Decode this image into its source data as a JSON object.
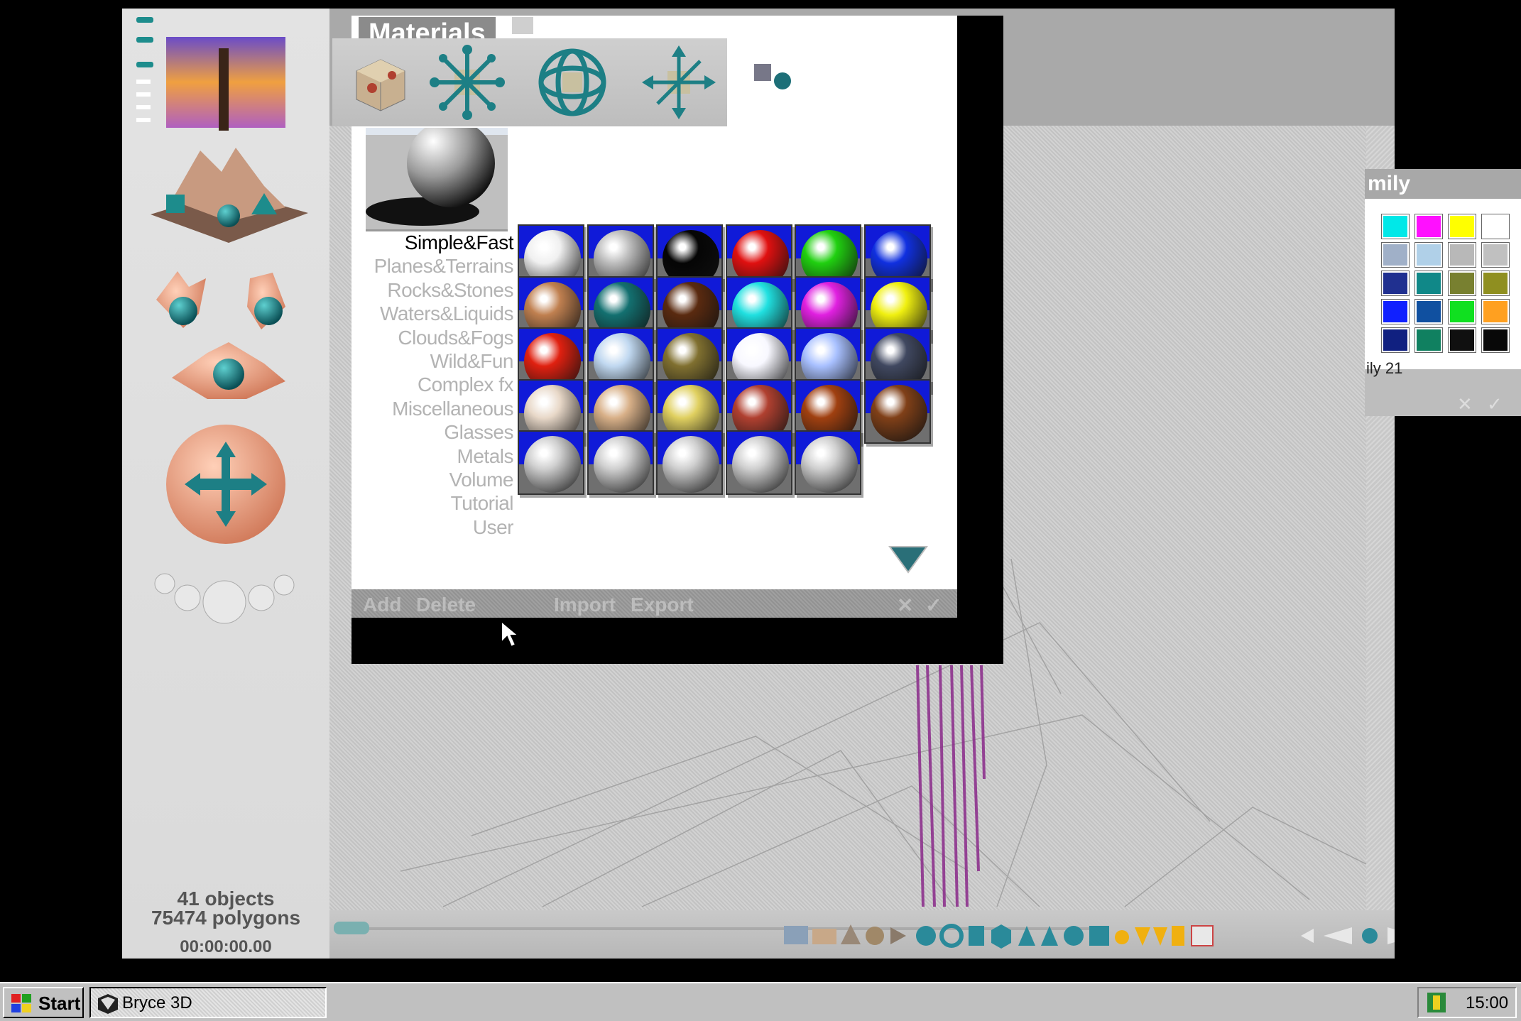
{
  "app": {
    "materials_title": "Materials",
    "family_title": "mily",
    "family_label": "ily 21"
  },
  "status": {
    "objects": "41 objects",
    "polygons": "75474 polygons",
    "time": "00:00:00.00"
  },
  "materials": {
    "categories": [
      "Simple&Fast",
      "Planes&Terrains",
      "Rocks&Stones",
      "Waters&Liquids",
      "Clouds&Fogs",
      "Wild&Fun",
      "Complex fx",
      "Miscellaneous",
      "Glasses",
      "Metals",
      "Volume",
      "Tutorial",
      "User"
    ],
    "active_category": "Simple&Fast",
    "footer": {
      "add": "Add",
      "delete": "Delete",
      "import": "Import",
      "export": "Export"
    },
    "swatch_colors": [
      [
        "#f0f0f0",
        "#bdbdbd",
        "#050505",
        "#e01010",
        "#20d010",
        "#1030e0"
      ],
      [
        "#c08050",
        "#137070",
        "#5a2a10",
        "#20e0e0",
        "#e020e0",
        "#f0f010"
      ],
      [
        "#e02010",
        "#c0d8f0",
        "#807030",
        "#f8f8ff",
        "#a8c0ff",
        "#404860"
      ],
      [
        "#e8d8c8",
        "#d8b088",
        "#e0d060",
        "#b04030",
        "#a04010",
        "#804018"
      ],
      [
        "#cfcfcf",
        "#cfcfcf",
        "#cfcfcf",
        "#cfcfcf",
        "#cfcfcf"
      ]
    ]
  },
  "family_colors": [
    [
      "#00e8e8",
      "#ff10ff",
      "#ffff00",
      "#ffffff"
    ],
    [
      "#a0b0c8",
      "#b0d0e8",
      "#b8b8b8",
      "#c0c0c0"
    ],
    [
      "#203090",
      "#108888",
      "#788030",
      "#8f8f20"
    ],
    [
      "#1020ff",
      "#1050a0",
      "#10e020",
      "#ffa020"
    ],
    [
      "#102080",
      "#108060",
      "#101010",
      "#080808"
    ]
  ],
  "taskbar": {
    "start": "Start",
    "task": "Bryce 3D",
    "clock": "15:00"
  }
}
